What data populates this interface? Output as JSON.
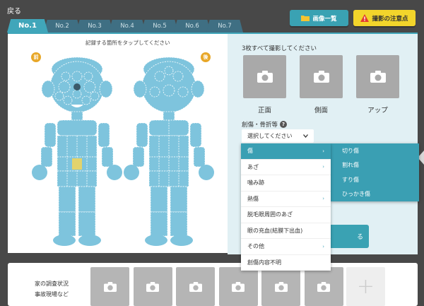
{
  "header": {
    "back_label": "戻る",
    "image_list_label": "画像一覧",
    "notes_label": "撮影の注意点"
  },
  "tabs": [
    "No.1",
    "No.2",
    "No.3",
    "No.4",
    "No.5",
    "No.6",
    "No.7"
  ],
  "left": {
    "title": "記録する箇所をタップしてください",
    "front_badge": "前",
    "back_badge": "後"
  },
  "right": {
    "title": "3枚すべて撮影してください",
    "photos": [
      "正面",
      "側面",
      "アップ"
    ],
    "injury_label": "創傷・骨折等",
    "help_icon": "?",
    "select_placeholder": "選択してください",
    "hidden_button_text": "る"
  },
  "menu": {
    "items": [
      {
        "label": "傷",
        "has_sub": true,
        "active": true
      },
      {
        "label": "あざ",
        "has_sub": true,
        "active": false
      },
      {
        "label": "噛み跡",
        "has_sub": false,
        "active": false
      },
      {
        "label": "熱傷",
        "has_sub": true,
        "active": false
      },
      {
        "label": "脱毛眼周囲のあざ",
        "has_sub": false,
        "active": false
      },
      {
        "label": "眼の充血(結膜下出血)",
        "has_sub": false,
        "active": false
      },
      {
        "label": "その他",
        "has_sub": true,
        "active": false
      },
      {
        "label": "創傷内容不明",
        "has_sub": false,
        "active": false
      }
    ],
    "submenu": [
      "切り傷",
      "割れ傷",
      "すり傷",
      "ひっかき傷"
    ]
  },
  "bottom": {
    "label_line1": "家の調査状況",
    "label_line2": "事故現場など",
    "plus": "+"
  },
  "colors": {
    "accent": "#40a6ba",
    "tab_inactive": "#3f6f83",
    "body": "#7ec4dd",
    "selected_part": "#e2d36c",
    "notes_yellow": "#f2d52b"
  }
}
